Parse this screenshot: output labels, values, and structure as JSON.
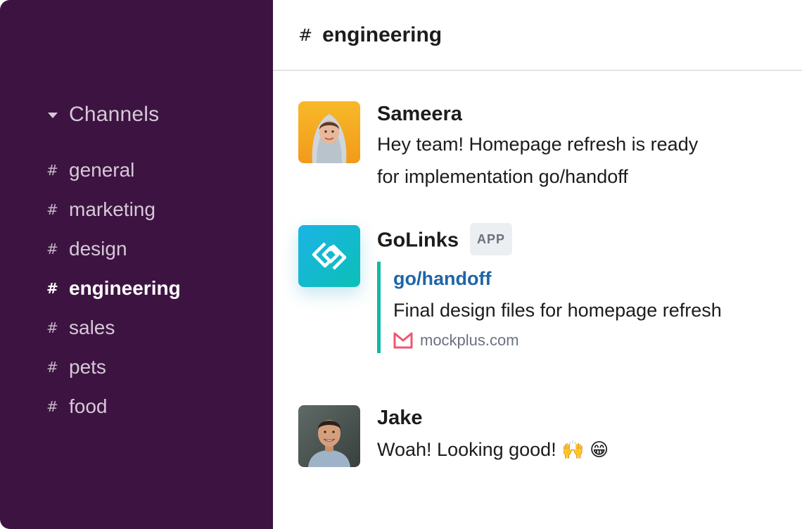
{
  "sidebar": {
    "section_title": "Channels",
    "channels": [
      {
        "name": "general"
      },
      {
        "name": "marketing"
      },
      {
        "name": "design"
      },
      {
        "name": "engineering"
      },
      {
        "name": "sales"
      },
      {
        "name": "pets"
      },
      {
        "name": "food"
      }
    ],
    "active_channel": "engineering"
  },
  "header": {
    "hash": "#",
    "channel_name": "engineering"
  },
  "messages": [
    {
      "author": "Sameera",
      "lines": [
        "Hey team! Homepage refresh is ready",
        "for implementation go/handoff"
      ]
    },
    {
      "author": "GoLinks",
      "badge": "APP",
      "attachment": {
        "link": "go/handoff",
        "description": "Final design files for homepage refresh",
        "source": "mockplus.com"
      }
    },
    {
      "author": "Jake",
      "text": "Woah! Looking good!",
      "emojis": [
        "🙌",
        "😁"
      ]
    }
  ],
  "colors": {
    "sidebar_bg": "#3d1441",
    "accent_link": "#1e65a7",
    "attachment_bar": "#13b8a4"
  }
}
